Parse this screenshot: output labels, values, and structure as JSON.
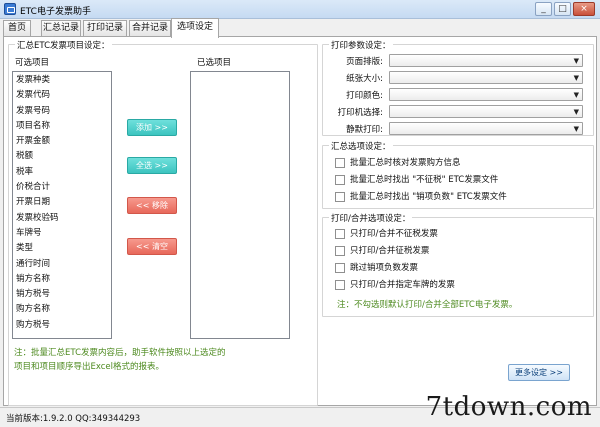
{
  "window": {
    "title": "ETC电子发票助手",
    "min": "_",
    "max": "□",
    "close": "×"
  },
  "tabs": [
    "首页",
    "汇总记录",
    "打印记录",
    "合并记录",
    "选项设定"
  ],
  "summary_fields": {
    "title": "汇总ETC发票项目设定：",
    "available_label": "可选项目",
    "selected_label": "已选项目",
    "available_items": [
      "发票种类",
      "发票代码",
      "发票号码",
      "项目名称",
      "开票金额",
      "税额",
      "税率",
      "价税合计",
      "开票日期",
      "发票校验码",
      "车牌号",
      "类型",
      "通行时间",
      "销方名称",
      "销方税号",
      "购方名称",
      "购方税号"
    ],
    "selected_items": [],
    "add_button": "添加 >>",
    "select_all_button": "全选 >>",
    "remove_button": "<< 移除",
    "clear_button": "<< 清空",
    "note_line1": "注：批量汇总ETC发票内容后，助手软件按照以上选定的",
    "note_line2": "项目和项目顺序导出Excel格式的报表。"
  },
  "print_params": {
    "title": "打印参数设定：",
    "fields": [
      {
        "label": "页面排版:",
        "value": ""
      },
      {
        "label": "纸张大小:",
        "value": ""
      },
      {
        "label": "打印颜色:",
        "value": ""
      },
      {
        "label": "打印机选择:",
        "value": ""
      },
      {
        "label": "静默打印:",
        "value": ""
      }
    ]
  },
  "summary_options": {
    "title": "汇总选项设定：",
    "items": [
      {
        "label": "批量汇总时核对发票购方信息",
        "checked": false
      },
      {
        "label": "批量汇总时找出 \"不征税\" ETC发票文件",
        "checked": false
      },
      {
        "label": "批量汇总时找出 \"销项负数\" ETC发票文件",
        "checked": false
      }
    ]
  },
  "print_merge_options": {
    "title": "打印/合并选项设定：",
    "items": [
      {
        "label": "只打印/合并不征税发票",
        "checked": false
      },
      {
        "label": "只打印/合并征税发票",
        "checked": false
      },
      {
        "label": "跳过销项负数发票",
        "checked": false
      },
      {
        "label": "只打印/合并指定车牌的发票",
        "checked": false
      }
    ],
    "note": "注：不勾选则默认打印/合并全部ETC电子发票。"
  },
  "more_settings_button": "更多设定 >>",
  "status": {
    "text": "当前版本:1.9.2.0  QQ:349344293"
  },
  "watermark": "7tdown.com",
  "colors": {
    "teal": "#3cc4bf",
    "red": "#e8685a",
    "note_green": "#4d8a1f"
  }
}
